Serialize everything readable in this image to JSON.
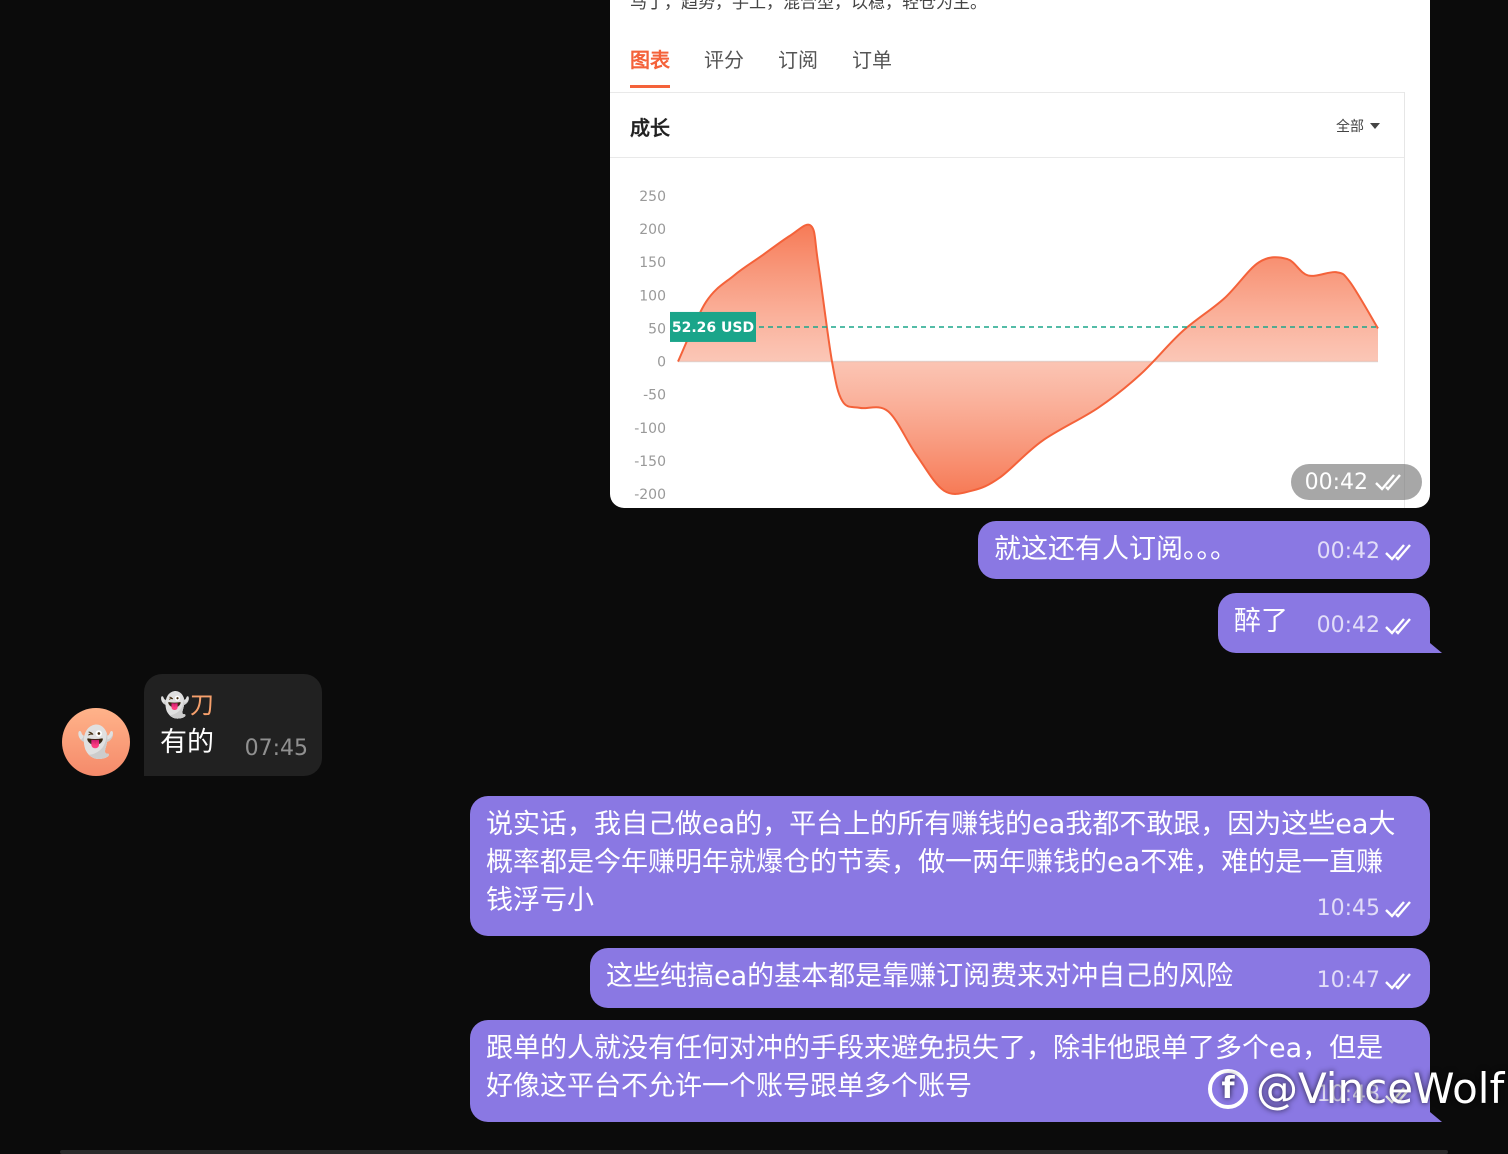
{
  "image_message": {
    "cut_text": "马丁，趋势，手工，混合型，以稳，轻仓为主。",
    "tabs": [
      {
        "label": "图表",
        "active": true
      },
      {
        "label": "评分",
        "active": false
      },
      {
        "label": "订阅",
        "active": false
      },
      {
        "label": "订单",
        "active": false
      }
    ],
    "section_title": "成长",
    "filter_label": "全部",
    "time": "00:42",
    "accent_color": "#f4623a",
    "chart_data": {
      "type": "area",
      "y_ticks": [
        250,
        200,
        150,
        100,
        50,
        0,
        -50,
        -100,
        -150,
        -200
      ],
      "ylim": [
        -200,
        250
      ],
      "reference_value": 52.26,
      "reference_label": "52.26 USD",
      "reference_color": "#1aa58a",
      "x": [
        0,
        0.04,
        0.08,
        0.12,
        0.16,
        0.19,
        0.2,
        0.22,
        0.235,
        0.26,
        0.3,
        0.34,
        0.38,
        0.42,
        0.46,
        0.52,
        0.6,
        0.66,
        0.72,
        0.78,
        0.83,
        0.87,
        0.9,
        0.94,
        0.96,
        1.0
      ],
      "values": [
        0,
        90,
        130,
        160,
        190,
        205,
        150,
        0,
        -60,
        -70,
        -75,
        -140,
        -195,
        -195,
        -175,
        -120,
        -70,
        -20,
        45,
        95,
        150,
        155,
        130,
        135,
        120,
        50
      ]
    }
  },
  "messages": [
    {
      "id": "m1",
      "text": "就这还有人订阅。。。",
      "time": "00:42",
      "status": "read"
    },
    {
      "id": "m2",
      "text": "醉了",
      "time": "00:42",
      "status": "read"
    },
    {
      "id": "m3",
      "sender": "👻刀",
      "avatar": "👻",
      "text": "有的",
      "time": "07:45"
    },
    {
      "id": "m4",
      "text": "说实话，我自己做ea的，平台上的所有赚钱的ea我都不敢跟，因为这些ea大概率都是今年赚明年就爆仓的节奏，做一两年赚钱的ea不难，难的是一直赚钱浮亏小",
      "time": "10:45",
      "status": "read"
    },
    {
      "id": "m5",
      "text": "这些纯搞ea的基本都是靠赚订阅费来对冲自己的风险",
      "time": "10:47",
      "status": "read"
    },
    {
      "id": "m6",
      "text": "跟单的人就没有任何对冲的手段来避免损失了，除非他跟单了多个ea，但是好像这平台不允许一个账号跟单多个账号",
      "time": "10:48",
      "status": "read"
    }
  ],
  "watermark": "@VinceWolf"
}
